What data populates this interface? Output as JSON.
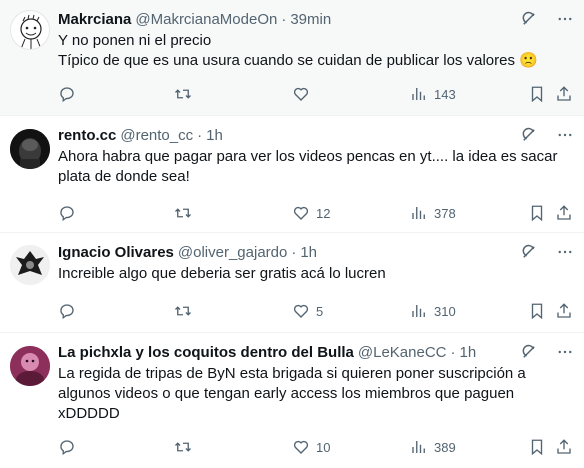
{
  "colors": {
    "text_primary": "#0f1419",
    "text_secondary": "#536471",
    "border": "#eff3f4",
    "highlight_bg": "#f7f9f9"
  },
  "tweets": [
    {
      "name": "Makrciana",
      "handle": "@MakrcianaModeOn",
      "separator": "·",
      "time": "39min",
      "text": "Y no ponen ni el precio\nTípico de que es una usura cuando se cuidan de publicar los valores 🙁",
      "replies": "",
      "retweets": "",
      "likes": "",
      "views": "143"
    },
    {
      "name": "rento.cc",
      "handle": "@rento_cc",
      "separator": "·",
      "time": "1h",
      "text": "Ahora habra que pagar para ver los videos pencas en yt.... la idea es sacar plata de donde sea!",
      "replies": "",
      "retweets": "",
      "likes": "12",
      "views": "378"
    },
    {
      "name": "Ignacio Olivares",
      "handle": "@oliver_gajardo",
      "separator": "·",
      "time": "1h",
      "text": "Increible algo que deberia ser gratis acá lo lucren",
      "replies": "",
      "retweets": "",
      "likes": "5",
      "views": "310"
    },
    {
      "name": "La pichxla y los coquitos dentro del Bulla",
      "handle": "@LeKaneCC",
      "separator": "·",
      "time": "1h",
      "text": "La regida de tripas de ByN esta brigada si quieren poner suscripción a algunos videos o que tengan early access los miembros que paguen xDDDDD",
      "replies": "",
      "retweets": "",
      "likes": "10",
      "views": "389"
    }
  ]
}
